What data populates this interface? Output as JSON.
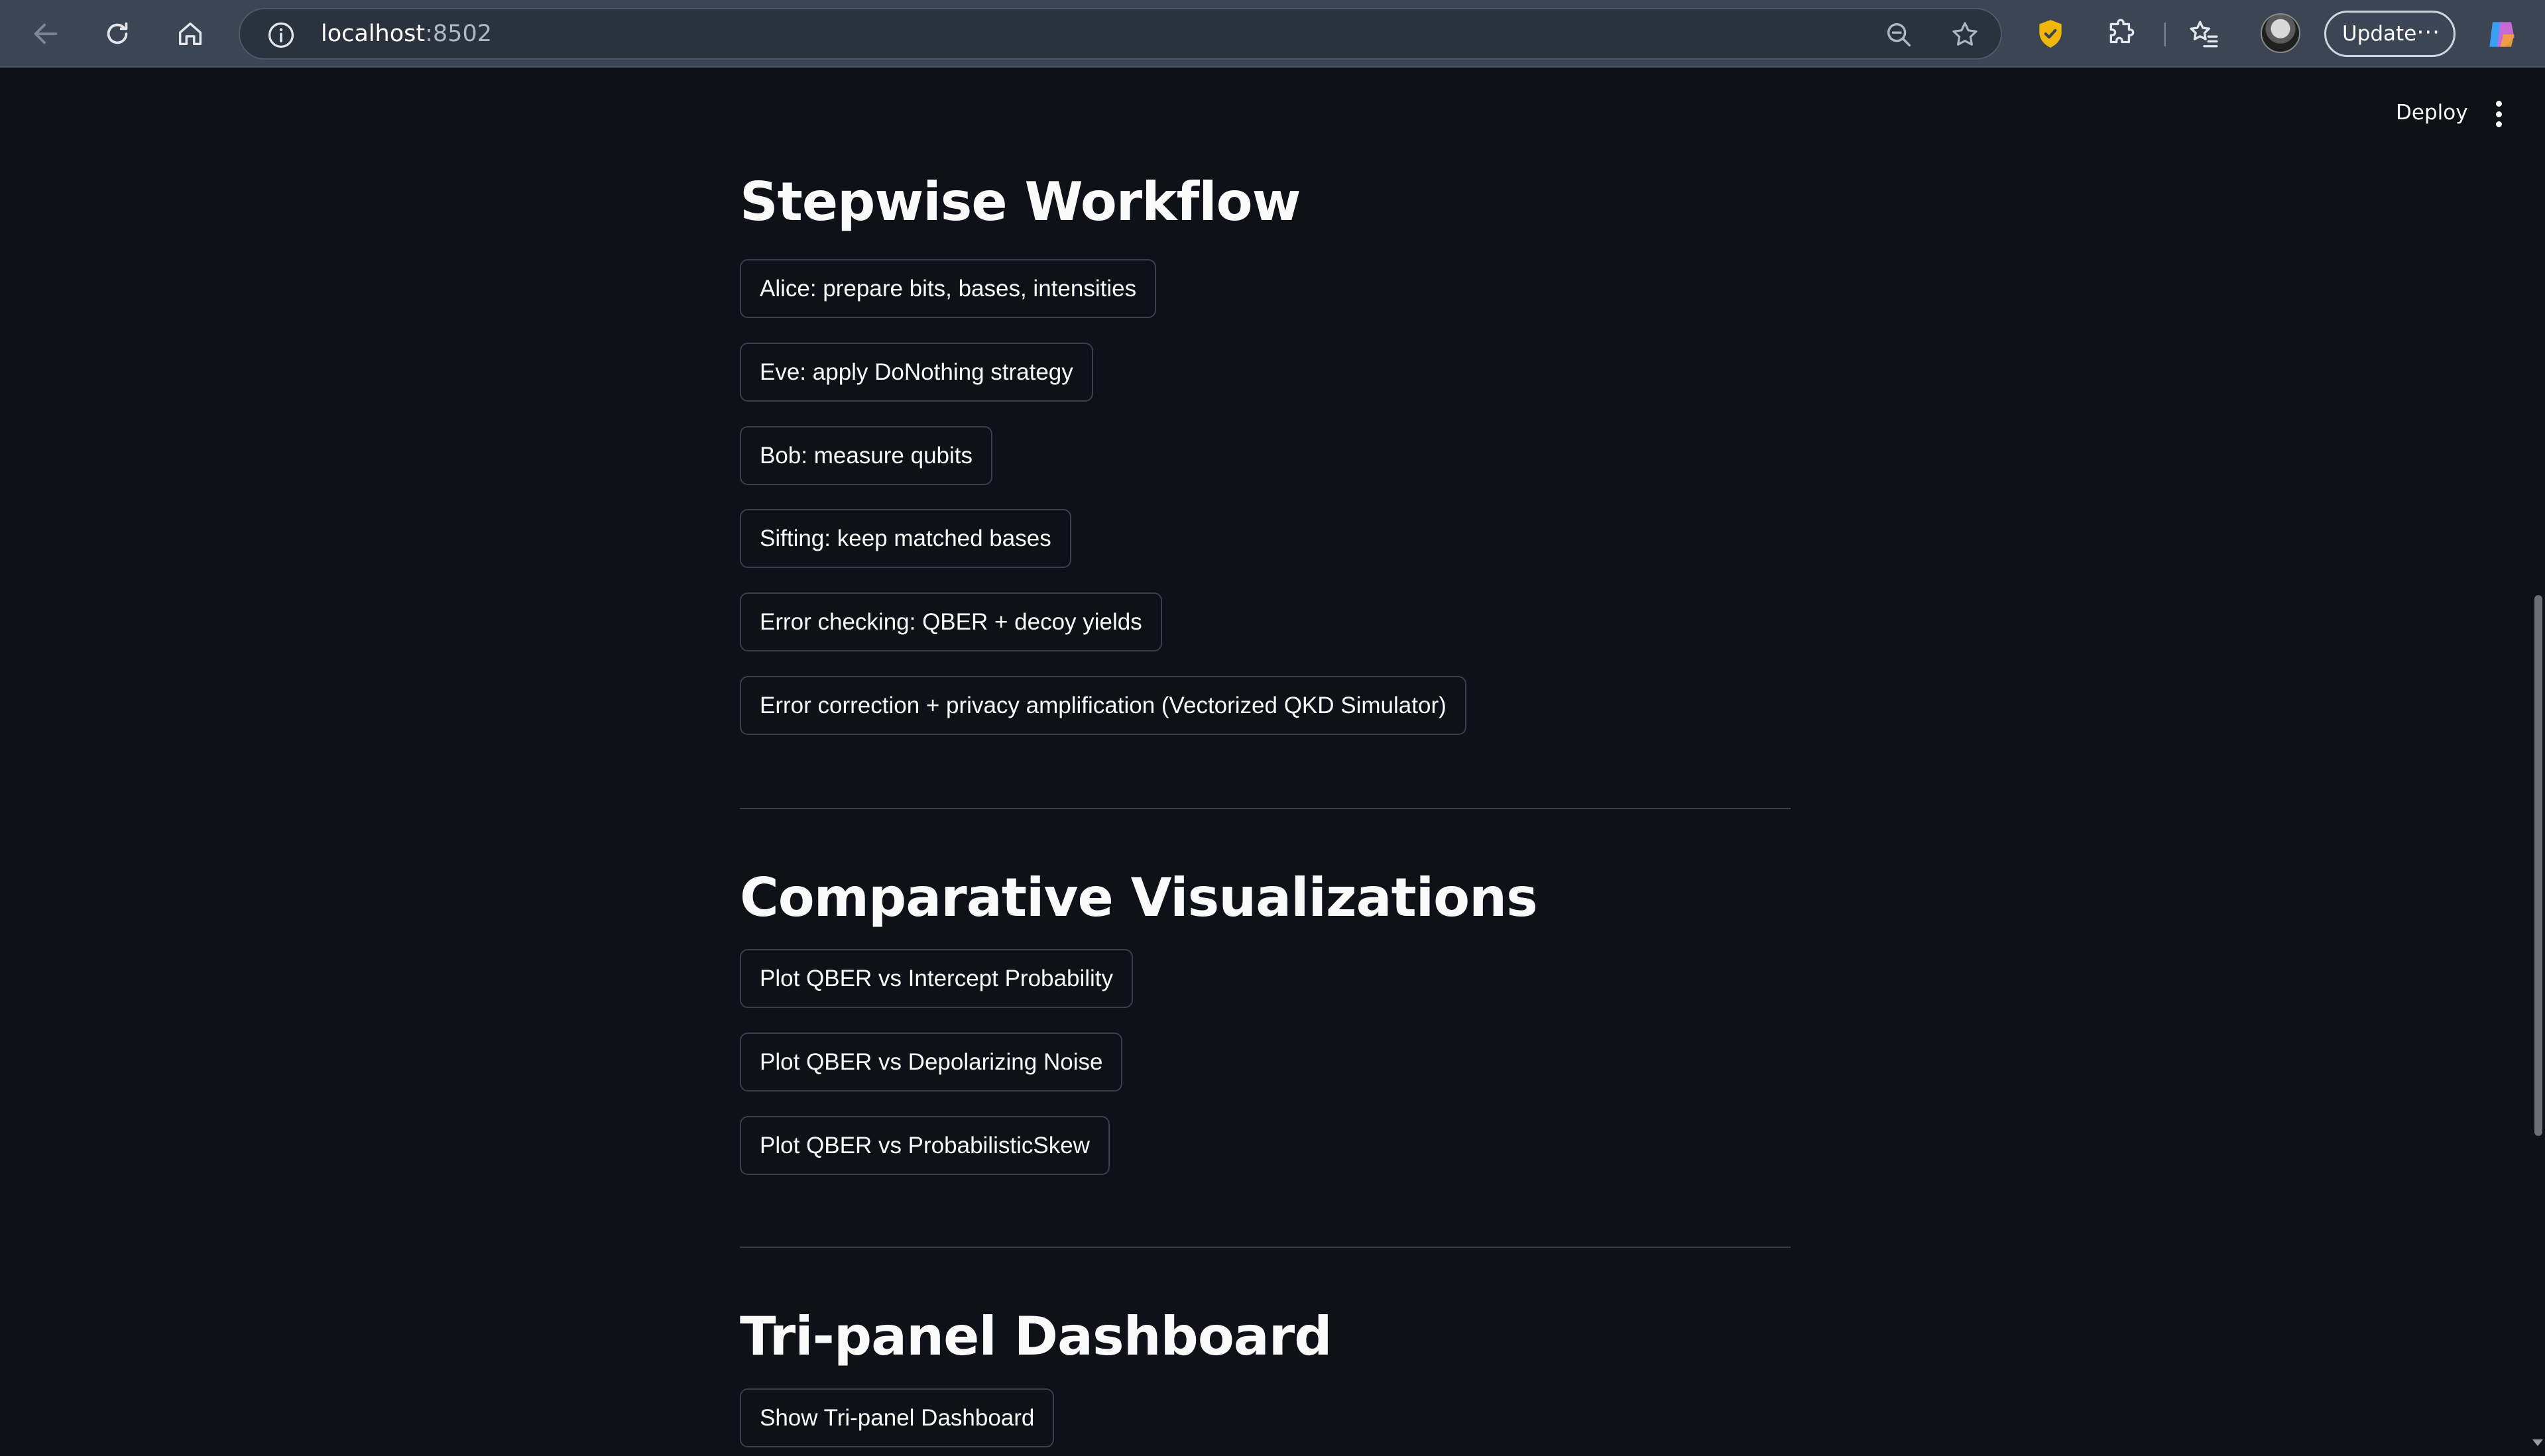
{
  "browser": {
    "url_host": "localhost",
    "url_port": ":8502",
    "update_label": "Update",
    "more_label": "···"
  },
  "header": {
    "deploy_label": "Deploy"
  },
  "sections": {
    "workflow": {
      "title": "Stepwise Workflow",
      "buttons": [
        "Alice: prepare bits, bases, intensities",
        "Eve: apply DoNothing strategy",
        "Bob: measure qubits",
        "Sifting: keep matched bases",
        "Error checking: QBER + decoy yields",
        "Error correction + privacy amplification (Vectorized QKD Simulator)"
      ]
    },
    "comparative": {
      "title": "Comparative Visualizations",
      "buttons": [
        "Plot QBER vs Intercept Probability",
        "Plot QBER vs Depolarizing Noise",
        "Plot QBER vs ProbabilisticSkew"
      ]
    },
    "dashboard": {
      "title": "Tri-panel Dashboard",
      "buttons": [
        "Show Tri-panel Dashboard"
      ]
    }
  },
  "colors": {
    "app_background": "#0e1117",
    "browser_chrome": "#3b4554",
    "button_border": "#3c3f49",
    "text": "#fafafa",
    "brave_shield": "#f1b708"
  }
}
